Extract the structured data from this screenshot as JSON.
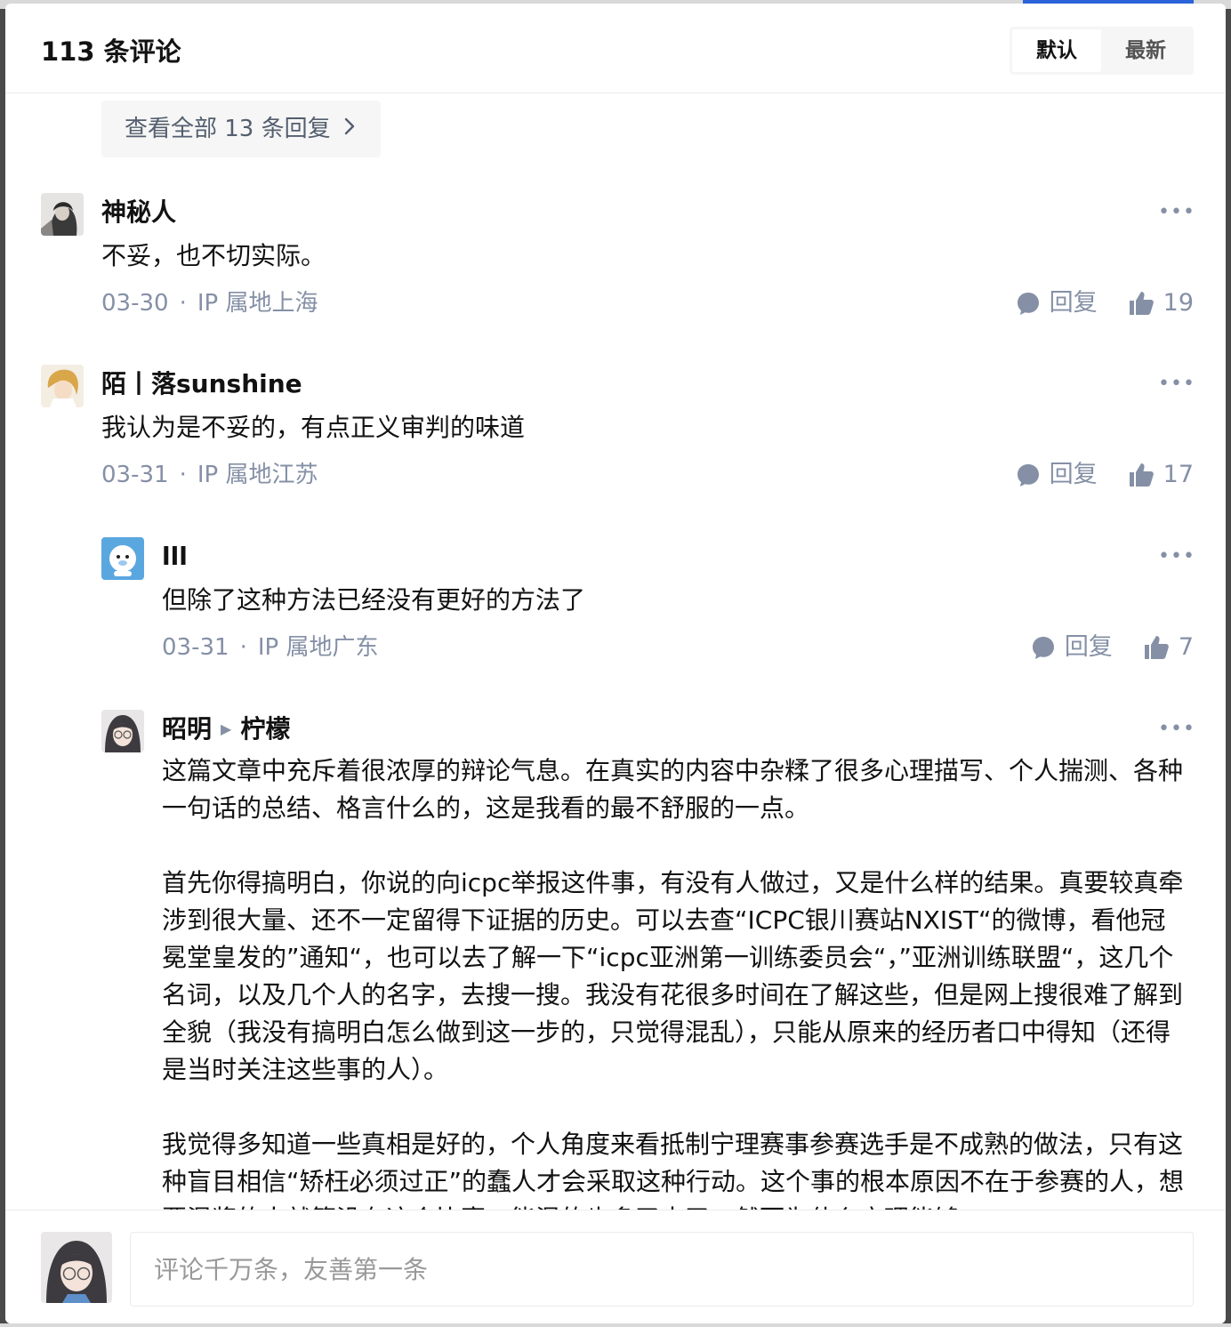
{
  "header": {
    "title": "113 条评论",
    "sort_tabs": [
      {
        "label": "默认",
        "active": true
      },
      {
        "label": "最新",
        "active": false
      }
    ]
  },
  "view_all_replies": {
    "label": "查看全部 13 条回复",
    "icon": "chevron-right-icon"
  },
  "comments": [
    {
      "author": "神秘人",
      "content": [
        "不妥，也不切实际。"
      ],
      "date": "03-30",
      "ip": "IP 属地上海",
      "reply_label": "回复",
      "likes": "19"
    },
    {
      "author": "陌丨落sunshine",
      "content": [
        "我认为是不妥的，有点正义审判的味道"
      ],
      "date": "03-31",
      "ip": "IP 属地江苏",
      "reply_label": "回复",
      "likes": "17"
    },
    {
      "author": "lll",
      "content": [
        "但除了这种方法已经没有更好的方法了"
      ],
      "date": "03-31",
      "ip": "IP 属地广东",
      "reply_label": "回复",
      "likes": "7"
    },
    {
      "author": "昭明",
      "reply_to": "柠檬",
      "content": [
        "这篇文章中充斥着很浓厚的辩论气息。在真实的内容中杂糅了很多心理描写、个人揣测、各种一句话的总结、格言什么的，这是我看的最不舒服的一点。",
        "首先你得搞明白，你说的向icpc举报这件事，有没有人做过，又是什么样的结果。真要较真牵涉到很大量、还不一定留得下证据的历史。可以去查“ICPC银川赛站NXIST“的微博，看他冠冕堂皇发的”通知“，也可以去了解一下“icpc亚洲第一训练委员会“，”亚洲训练联盟“，这几个名词，以及几个人的名字，去搜一搜。我没有花很多时间在了解这些，但是网上搜很难了解到全貌（我没有搞明白怎么做到这一步的，只觉得混乱），只能从原来的经历者口中得知（还得是当时关注这些事的人）。",
        "我觉得多知道一些真相是好的，个人角度来看抵制宁理赛事参赛选手是不成熟的做法，只有这种盲目相信“矫枉必须过正”的蠢人才会采取这种行动。这个事的根本原因不在于参赛的人，想要混奖的人就算没有这个比赛，能混的也多了去了，然而为什么宁理能够"
      ]
    }
  ],
  "footer": {
    "input_placeholder": "评论千万条，友善第一条"
  },
  "colors": {
    "text_primary": "#121212",
    "text_secondary": "#8590a6",
    "divider": "#ebebeb",
    "tab_bg": "#f6f6f6"
  }
}
